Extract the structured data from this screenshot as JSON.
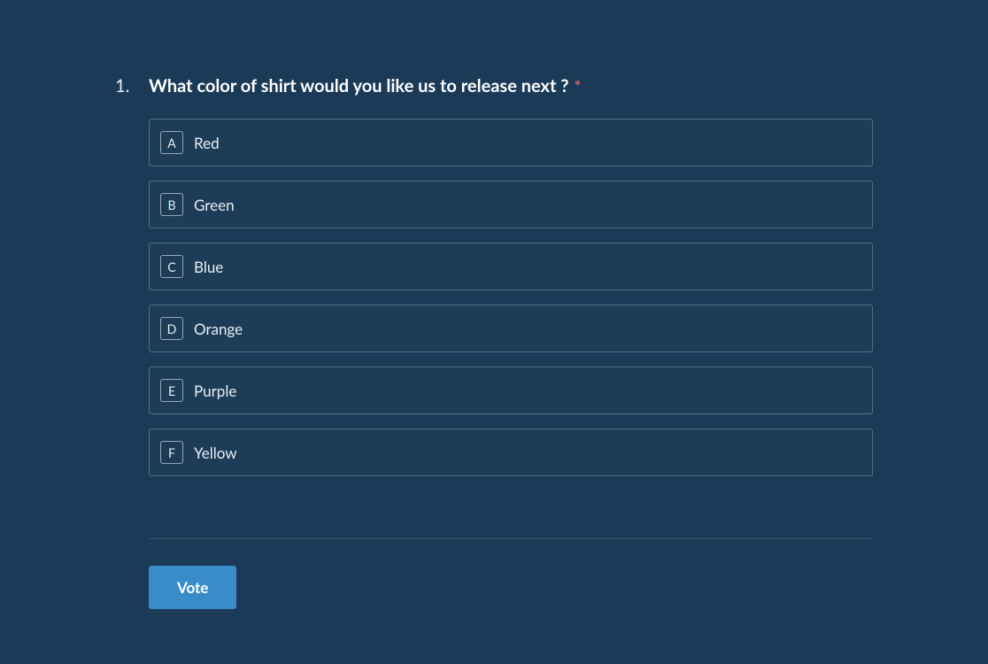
{
  "question": {
    "number": "1.",
    "text": "What color of shirt would you like us to release next ?",
    "required_marker": "*",
    "options": [
      {
        "key": "A",
        "label": "Red"
      },
      {
        "key": "B",
        "label": "Green"
      },
      {
        "key": "C",
        "label": "Blue"
      },
      {
        "key": "D",
        "label": "Orange"
      },
      {
        "key": "E",
        "label": "Purple"
      },
      {
        "key": "F",
        "label": "Yellow"
      }
    ]
  },
  "actions": {
    "vote_label": "Vote"
  }
}
